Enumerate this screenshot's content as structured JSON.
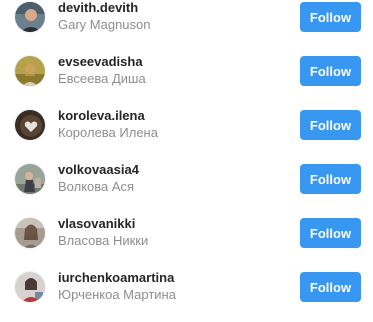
{
  "suggestions": [
    {
      "username": "devith.devith",
      "fullname": "Gary Magnuson",
      "button": "Follow",
      "avatar_icon": "profile-photo-icon"
    },
    {
      "username": "evseevadisha",
      "fullname": "Евсеева Диша",
      "button": "Follow",
      "avatar_icon": "profile-photo-icon"
    },
    {
      "username": "koroleva.ilena",
      "fullname": "Королева Илена",
      "button": "Follow",
      "avatar_icon": "profile-photo-icon"
    },
    {
      "username": "volkovaasia4",
      "fullname": "Волкова Ася",
      "button": "Follow",
      "avatar_icon": "profile-photo-icon"
    },
    {
      "username": "vlasovanikki",
      "fullname": "Власова Никки",
      "button": "Follow",
      "avatar_icon": "profile-photo-icon"
    },
    {
      "username": "iurchenkoamartina",
      "fullname": "Юрченкоа Мартина",
      "button": "Follow",
      "avatar_icon": "profile-photo-icon"
    }
  ],
  "colors": {
    "follow_button": "#3897f0",
    "username_text": "#262626",
    "fullname_text": "#8e8e8e"
  }
}
